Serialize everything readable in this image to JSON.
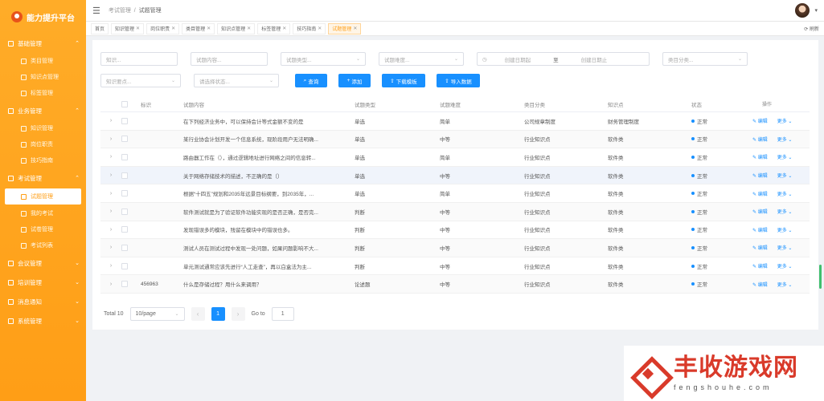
{
  "app": {
    "title": "能力提升平台"
  },
  "sidebar": {
    "groups": [
      {
        "title": "基础管理",
        "items": [
          "类目管理",
          "知识点管理",
          "标签管理"
        ]
      },
      {
        "title": "业务管理",
        "items": [
          "知识管理",
          "岗位职责",
          "技巧指南"
        ]
      },
      {
        "title": "考试管理",
        "items": [
          "试题管理",
          "我的考试",
          "试卷管理",
          "考试列表"
        ],
        "active": 0
      },
      {
        "title": "会议管理",
        "items": []
      },
      {
        "title": "培训管理",
        "items": []
      },
      {
        "title": "消息通知",
        "items": []
      },
      {
        "title": "系统管理",
        "items": []
      }
    ]
  },
  "topbar": {
    "breadcrumb_parent": "考试管理",
    "breadcrumb_current": "试题管理"
  },
  "tags": [
    "首页",
    "知识管理",
    "岗位职责",
    "类目管理",
    "知识点管理",
    "标签管理",
    "技巧指南",
    "试题管理"
  ],
  "tags_active": "试题管理",
  "refresh_label": "刷新",
  "filters": {
    "kp_placeholder": "知识...",
    "content_placeholder": "试题内容...",
    "type_placeholder": "试题类型...",
    "difficulty_placeholder": "试题难度...",
    "date_start": "创建日期起",
    "date_end": "创建日期止",
    "category_placeholder": "类目分类...",
    "kp_select_placeholder": "知识要点...",
    "status_placeholder": "请选择状态..."
  },
  "buttons": {
    "query": "查询",
    "add": "添加",
    "download": "下载模板",
    "import": "导入数据"
  },
  "table": {
    "headers": [
      "标识",
      "试题内容",
      "试题类型",
      "试题难度",
      "类目分类",
      "知识点",
      "状态",
      "操作"
    ],
    "rows": [
      {
        "id": "",
        "content": "在下列经济业务中，可以保持会计等式金额不变的是",
        "type": "单选",
        "difficulty": "简单",
        "category": "公司规章制度",
        "kp": "财务管理制度",
        "status": "正常"
      },
      {
        "id": "",
        "content": "某行业协会计划开发一个信息系统，现阶段用户无法明确...",
        "type": "单选",
        "difficulty": "中等",
        "category": "行业知识点",
        "kp": "软件类",
        "status": "正常"
      },
      {
        "id": "",
        "content": "路由器工作在（），通过逻辑地址进行网络之间的信息转...",
        "type": "单选",
        "difficulty": "简单",
        "category": "行业知识点",
        "kp": "软件类",
        "status": "正常"
      },
      {
        "id": "",
        "content": "关于网络存储技术的描述，不正确的是（）",
        "type": "单选",
        "difficulty": "中等",
        "category": "行业知识点",
        "kp": "软件类",
        "status": "正常"
      },
      {
        "id": "",
        "content": "根据“十四五”规划和2035年远景目标纲要，到2035年，...",
        "type": "单选",
        "difficulty": "简单",
        "category": "行业知识点",
        "kp": "软件类",
        "status": "正常"
      },
      {
        "id": "",
        "content": "软件测试就是为了验证软件功能实现的是否正确，是否完...",
        "type": "判断",
        "difficulty": "中等",
        "category": "行业知识点",
        "kp": "软件类",
        "status": "正常"
      },
      {
        "id": "",
        "content": "发现错误多的模块，残留在模块中的错误也多。",
        "type": "判断",
        "difficulty": "中等",
        "category": "行业知识点",
        "kp": "软件类",
        "status": "正常"
      },
      {
        "id": "",
        "content": "测试人员在测试过程中发现一处问题，如果问题影响不大...",
        "type": "判断",
        "difficulty": "中等",
        "category": "行业知识点",
        "kp": "软件类",
        "status": "正常"
      },
      {
        "id": "",
        "content": "单元测试通常应该先进行“人工走查”，再以白盒法为主...",
        "type": "判断",
        "difficulty": "中等",
        "category": "行业知识点",
        "kp": "软件类",
        "status": "正常"
      },
      {
        "id": "456963",
        "content": "什么是存储过程？用什么来调用？",
        "type": "论述题",
        "difficulty": "中等",
        "category": "行业知识点",
        "kp": "软件类",
        "status": "正常"
      }
    ],
    "op_edit": "编辑",
    "op_more": "更多"
  },
  "pagination": {
    "total": "Total 10",
    "page_size": "10/page",
    "current_page": "1",
    "goto_label": "Go to",
    "goto_value": "1"
  },
  "watermark": {
    "title": "丰收游戏网",
    "subtitle": "fengshouhe.com"
  },
  "colors": {
    "sidebar": "#ff9e16",
    "primary": "#1890ff",
    "watermark": "#d93a2a"
  }
}
